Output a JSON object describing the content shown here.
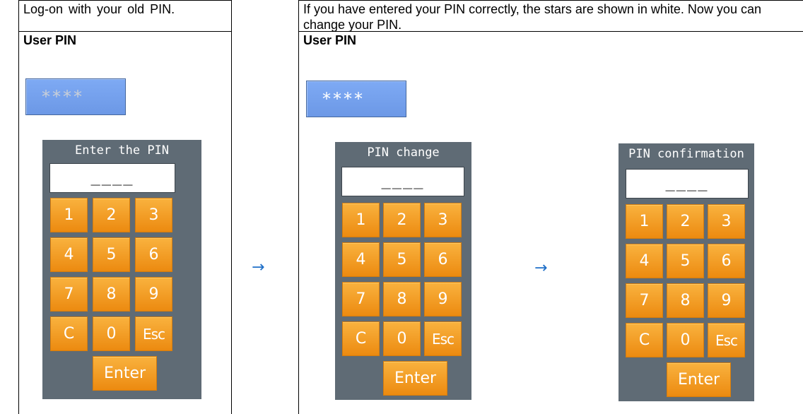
{
  "left": {
    "caption": "Log-on with your old PIN.",
    "label": "User PIN",
    "stars": "****",
    "keypad": {
      "title": "Enter the PIN",
      "field_value": "____",
      "keys": [
        "1",
        "2",
        "3",
        "4",
        "5",
        "6",
        "7",
        "8",
        "9",
        "C",
        "0",
        "Esc"
      ],
      "enter": "Enter"
    }
  },
  "right": {
    "caption": "If you have entered your PIN correctly, the stars are shown in white. Now you can change your PIN.",
    "label": "User PIN",
    "stars": "****",
    "keypad_change": {
      "title": "PIN change",
      "field_value": "____",
      "keys": [
        "1",
        "2",
        "3",
        "4",
        "5",
        "6",
        "7",
        "8",
        "9",
        "C",
        "0",
        "Esc"
      ],
      "enter": "Enter"
    },
    "keypad_confirm": {
      "title": "PIN confirmation",
      "field_value": "____",
      "keys": [
        "1",
        "2",
        "3",
        "4",
        "5",
        "6",
        "7",
        "8",
        "9",
        "C",
        "0",
        "Esc"
      ],
      "enter": "Enter"
    }
  },
  "arrows": [
    "→",
    "→"
  ],
  "colors": {
    "key_orange": "#f39a1e",
    "keypad_gray": "#5f6b75",
    "pin_display_blue": "#75a0ee",
    "arrow_blue": "#1f6fc8"
  }
}
